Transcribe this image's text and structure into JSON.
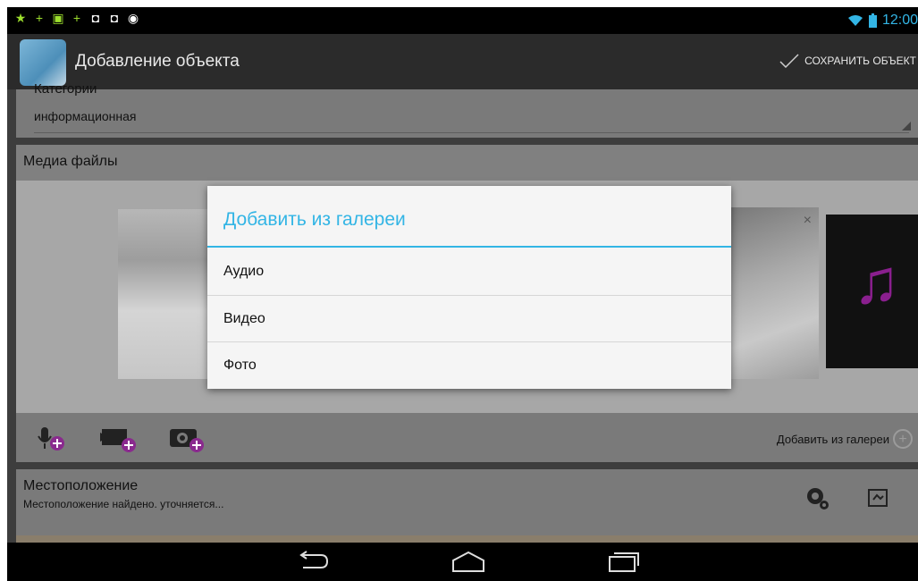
{
  "status_bar": {
    "time": "12:00",
    "notification_icons": [
      "star-icon",
      "plus-icon",
      "image-icon",
      "plus-icon",
      "bag-icon",
      "bag-icon",
      "cat-icon"
    ]
  },
  "action_bar": {
    "title": "Добавление объекта",
    "save_label": "СОХРАНИТЬ ОБЪЕКТ"
  },
  "category": {
    "label": "Категории",
    "value": "информационная"
  },
  "media": {
    "title": "Медиа файлы",
    "add_from_gallery": "Добавить из галереи",
    "action_icons": [
      "mic-add-icon",
      "video-add-icon",
      "camera-add-icon"
    ]
  },
  "location": {
    "title": "Местоположение",
    "status": "Местоположение найдено. уточняется..."
  },
  "dialog": {
    "title": "Добавить из галереи",
    "items": [
      "Аудио",
      "Видео",
      "Фото"
    ]
  },
  "colors": {
    "accent": "#33b5e5",
    "overlay": "#000000"
  }
}
